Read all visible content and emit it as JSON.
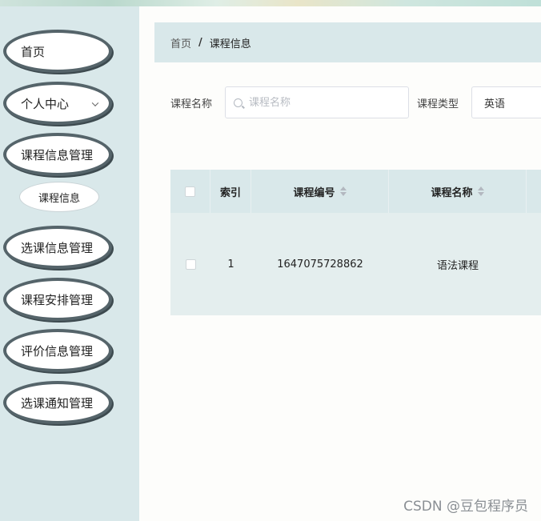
{
  "sidebar": {
    "items": [
      {
        "label": "首页"
      },
      {
        "label": "个人中心"
      },
      {
        "label": "课程信息管理"
      },
      {
        "label": "课程信息"
      },
      {
        "label": "选课信息管理"
      },
      {
        "label": "课程安排管理"
      },
      {
        "label": "评价信息管理"
      },
      {
        "label": "选课通知管理"
      }
    ]
  },
  "breadcrumb": {
    "home": "首页",
    "separator": "/",
    "current": "课程信息"
  },
  "search": {
    "name_label": "课程名称",
    "name_placeholder": "课程名称",
    "type_label": "课程类型",
    "type_value": "英语"
  },
  "table": {
    "columns": [
      "索引",
      "课程编号",
      "课程名称"
    ],
    "rows": [
      {
        "index": "1",
        "course_code": "1647075728862",
        "course_name": "语法课程"
      }
    ]
  },
  "watermark": "CSDN @豆包程序员"
}
